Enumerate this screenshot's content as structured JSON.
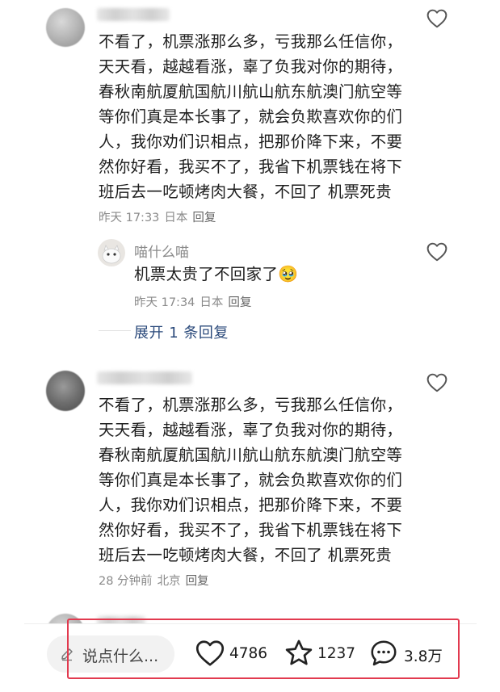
{
  "comments": [
    {
      "text_lines": [
        "不看了，机票涨那么多，亏我那么任信你，",
        "天天看，越越看涨，辜了负我对你的期待，",
        "春秋南航厦航国航川航山航东航澳门航空等",
        "等你们真是本长事了，就会负欺喜欢你的们",
        "人，我你劝们识相点，把那价降下来，不要",
        "然你好看，我买不了，我省下机票钱在将下",
        "班后去一吃顿烤肉大餐，不回了 机票死贵"
      ],
      "time": "昨天 17:33",
      "location": "日本",
      "reply_label": "回复",
      "reply": {
        "username": "喵什么喵",
        "text": "机票太贵了不回家了",
        "emoji": "🥹",
        "time": "昨天 17:34",
        "location": "日本",
        "reply_label": "回复"
      },
      "expand_label": "展开 1 条回复"
    },
    {
      "text_lines": [
        "不看了，机票涨那么多，亏我那么任信你，",
        "天天看，越越看涨，辜了负我对你的期待，",
        "春秋南航厦航国航川航山航东航澳门航空等",
        "等你们真是本长事了，就会负欺喜欢你的们",
        "人，我你劝们识相点，把那价降下来，不要",
        "然你好看，我买不了，我省下机票钱在将下",
        "班后去一吃顿烤肉大餐，不回了 机票死贵"
      ],
      "time": "28 分钟前",
      "location": "北京",
      "reply_label": "回复"
    }
  ],
  "bottom_bar": {
    "input_placeholder": "说点什么...",
    "likes": "4786",
    "favorites": "1237",
    "comments": "3.8万"
  },
  "colors": {
    "highlight_box": "#e23a4f",
    "link": "#2b4a7b",
    "meta_text": "#8a8a8a"
  }
}
